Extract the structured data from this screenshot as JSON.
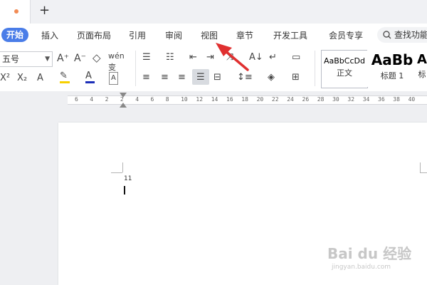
{
  "tabbar": {
    "new_tab_label": "+"
  },
  "menubar": {
    "items": [
      "开始",
      "插入",
      "页面布局",
      "引用",
      "审阅",
      "视图",
      "章节",
      "开发工具",
      "会员专享"
    ],
    "search": "查找功能"
  },
  "ribbon": {
    "font_size": "五号",
    "styles": [
      {
        "sample": "AaBbCcDd",
        "name": "正文"
      },
      {
        "sample": "AaBb",
        "name": "标题 1"
      },
      {
        "sample": "Aa",
        "name": "标"
      }
    ]
  },
  "ruler": {
    "labels": [
      "6",
      "4",
      "2",
      "2",
      "4",
      "6",
      "8",
      "10",
      "12",
      "14",
      "16",
      "18",
      "20",
      "22",
      "24",
      "26",
      "28",
      "30",
      "32",
      "34",
      "36",
      "38",
      "40"
    ]
  },
  "document": {
    "text": "11"
  },
  "watermark": {
    "brand": "Bai du 经验",
    "url": "jingyan.baidu.com"
  },
  "colors": {
    "accent": "#4a7de8",
    "highlight": "#f7d000",
    "font_color": "#1c2fb8",
    "annotation_arrow": "#e03030"
  }
}
